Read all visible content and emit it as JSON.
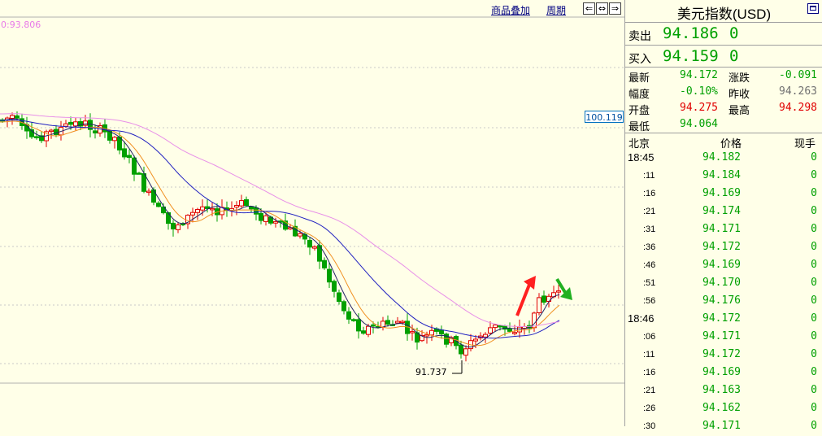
{
  "toolbar": {
    "overlay_link": "商品叠加",
    "period_link": "周期",
    "nav_buttons": [
      "⇐",
      "⇔",
      "⇒"
    ]
  },
  "chart": {
    "ma_value": "0:93.806",
    "price_tag": "100.119",
    "low_label": "91.737"
  },
  "colors": {
    "bull": "#e00000",
    "bear": "#00a000",
    "ma_short": "#222266",
    "ma_orange": "#f09020",
    "ma_blue": "#2020c0",
    "ma_pink": "#e890e8",
    "up_arrow": "#ff2020",
    "down_arrow": "#20b020"
  },
  "panel": {
    "title": "美元指数(USD)",
    "sell_label": "卖出",
    "sell_price": "94.186",
    "sell_vol": "0",
    "buy_label": "买入",
    "buy_price": "94.159",
    "buy_vol": "0",
    "quotes": {
      "latest_label": "最新",
      "latest_value": "94.172",
      "change_label": "涨跌",
      "change_value": "-0.091",
      "amp_label": "幅度",
      "amp_value": "-0.10%",
      "prevclose_label": "昨收",
      "prevclose_value": "94.263",
      "open_label": "开盘",
      "open_value": "94.275",
      "high_label": "最高",
      "high_value": "94.298",
      "low_label": "最低",
      "low_value": "94.064"
    },
    "ticks_header": {
      "time": "北京",
      "price": "价格",
      "vol": "现手"
    },
    "ticks": [
      {
        "time": "18:45",
        "price": "94.182",
        "vol": "0",
        "sub": false
      },
      {
        "time": ":11",
        "price": "94.184",
        "vol": "0",
        "sub": true
      },
      {
        "time": ":16",
        "price": "94.169",
        "vol": "0",
        "sub": true
      },
      {
        "time": ":21",
        "price": "94.174",
        "vol": "0",
        "sub": true
      },
      {
        "time": ":31",
        "price": "94.171",
        "vol": "0",
        "sub": true
      },
      {
        "time": ":36",
        "price": "94.172",
        "vol": "0",
        "sub": true
      },
      {
        "time": ":46",
        "price": "94.169",
        "vol": "0",
        "sub": true
      },
      {
        "time": ":51",
        "price": "94.170",
        "vol": "0",
        "sub": true
      },
      {
        "time": ":56",
        "price": "94.176",
        "vol": "0",
        "sub": true
      },
      {
        "time": "18:46",
        "price": "94.172",
        "vol": "0",
        "sub": false
      },
      {
        "time": ":06",
        "price": "94.171",
        "vol": "0",
        "sub": true
      },
      {
        "time": ":11",
        "price": "94.172",
        "vol": "0",
        "sub": true
      },
      {
        "time": ":16",
        "price": "94.169",
        "vol": "0",
        "sub": true
      },
      {
        "time": ":21",
        "price": "94.163",
        "vol": "0",
        "sub": true
      },
      {
        "time": ":26",
        "price": "94.162",
        "vol": "0",
        "sub": true
      },
      {
        "time": ":30",
        "price": "94.171",
        "vol": "0",
        "sub": true
      }
    ]
  }
}
